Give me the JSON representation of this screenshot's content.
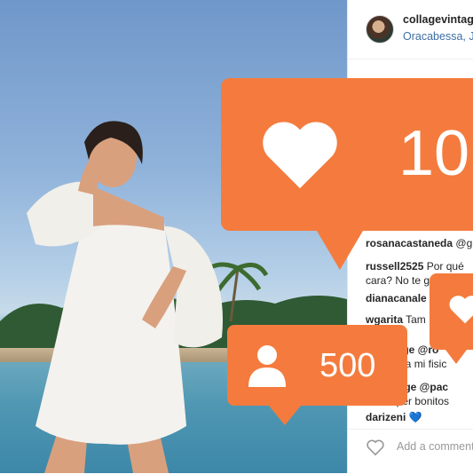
{
  "post": {
    "username": "collagevintag",
    "location": "Oracabessa, J"
  },
  "comments": [
    {
      "user": "rosanacastaneda",
      "text": " @g"
    },
    {
      "user": "russell2525",
      "text": " Por qué"
    },
    {
      "user": "",
      "text": "cara? No te g"
    },
    {
      "user": "dianacanale",
      "text": ""
    },
    {
      "user": "wgarita",
      "text": " Tam"
    },
    {
      "user": "",
      "text": "intage @ro"
    },
    {
      "user": "",
      "text": "gusta mi fisic"
    },
    {
      "user": "",
      "text": "intage @pac"
    },
    {
      "user": "",
      "text": "super bonitos"
    },
    {
      "user": "darizeni",
      "text": " 💙"
    }
  ],
  "add_comment_placeholder": "Add a comment",
  "notifications": {
    "likes": "10",
    "followers": "500"
  },
  "colors": {
    "bubble": "#f47b3d",
    "link": "#3e6ea3"
  },
  "icons": [
    "heart-icon",
    "user-icon",
    "heart-outline-icon"
  ]
}
